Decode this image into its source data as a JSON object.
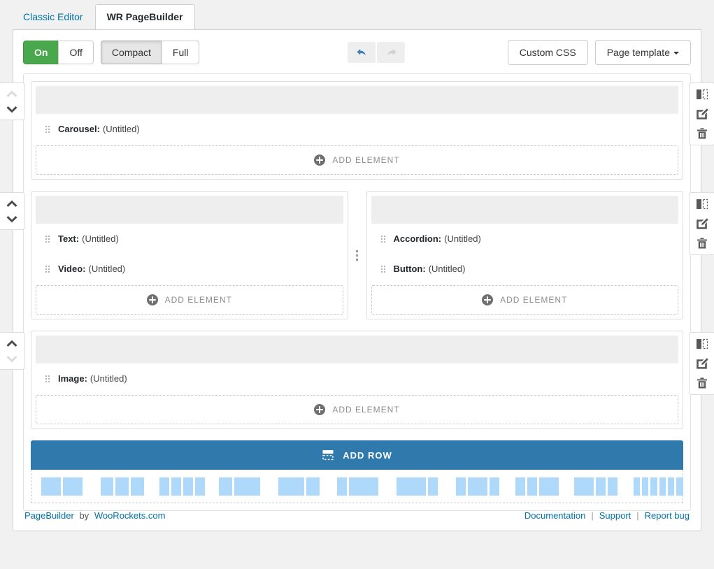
{
  "tabs": [
    {
      "label": "Classic Editor",
      "active": false,
      "name": "tab-classic-editor"
    },
    {
      "label": "WR PageBuilder",
      "active": true,
      "name": "tab-wr-pagebuilder"
    }
  ],
  "toolbar": {
    "on_label": "On",
    "off_label": "Off",
    "compact_label": "Compact",
    "full_label": "Full",
    "undo_icon": "undo-arrow-icon",
    "redo_icon": "redo-arrow-icon",
    "custom_css_label": "Custom CSS",
    "page_template_label": "Page template",
    "accent_green": "#48a84b",
    "accent_blue": "#3079ad",
    "link_blue": "#0073aa"
  },
  "rows": [
    {
      "name": "row-1",
      "move_up_enabled": false,
      "move_down_enabled": true,
      "columns": [
        {
          "name": "column-1-1",
          "elements": [
            {
              "type": "Carousel:",
              "title": "(Untitled)"
            }
          ],
          "add_element_label": "ADD ELEMENT"
        }
      ]
    },
    {
      "name": "row-2",
      "move_up_enabled": true,
      "move_down_enabled": true,
      "columns": [
        {
          "name": "column-2-1",
          "elements": [
            {
              "type": "Text:",
              "title": "(Untitled)"
            },
            {
              "type": "Video:",
              "title": "(Untitled)"
            }
          ],
          "add_element_label": "ADD ELEMENT"
        },
        {
          "name": "column-2-2",
          "elements": [
            {
              "type": "Accordion:",
              "title": "(Untitled)"
            },
            {
              "type": "Button:",
              "title": "(Untitled)"
            }
          ],
          "add_element_label": "ADD ELEMENT"
        }
      ]
    },
    {
      "name": "row-3",
      "move_up_enabled": true,
      "move_down_enabled": false,
      "columns": [
        {
          "name": "column-3-1",
          "elements": [
            {
              "type": "Image:",
              "title": "(Untitled)"
            }
          ],
          "add_element_label": "ADD ELEMENT"
        }
      ]
    }
  ],
  "row_controls": {
    "move_up_icon": "chevron-up-icon",
    "move_down_icon": "chevron-down-icon",
    "columns_icon": "columns-layout-icon",
    "edit_icon": "edit-pencil-icon",
    "delete_icon": "trash-icon"
  },
  "add_row": {
    "label": "ADD ROW",
    "icon": "add-row-icon",
    "layouts": [
      {
        "name": "layout-2-equal",
        "widths": [
          50,
          50
        ]
      },
      {
        "name": "layout-3-equal",
        "widths": [
          33.33,
          33.33,
          33.33
        ]
      },
      {
        "name": "layout-4-equal",
        "widths": [
          25,
          25,
          25,
          25
        ]
      },
      {
        "name": "layout-third-twothirds",
        "widths": [
          33.33,
          66.67
        ]
      },
      {
        "name": "layout-twothirds-third",
        "widths": [
          66.67,
          33.33
        ]
      },
      {
        "name": "layout-quarter-threequarters",
        "widths": [
          25,
          75
        ]
      },
      {
        "name": "layout-threequarters-quarter",
        "widths": [
          75,
          25
        ]
      },
      {
        "name": "layout-quarter-half-quarter",
        "widths": [
          25,
          50,
          25
        ]
      },
      {
        "name": "layout-quarter-quarter-half",
        "widths": [
          25,
          25,
          50
        ]
      },
      {
        "name": "layout-half-quarter-quarter",
        "widths": [
          50,
          25,
          25
        ]
      },
      {
        "name": "layout-6-equal",
        "widths": [
          16.6,
          16.6,
          16.6,
          16.6,
          16.6,
          16.6
        ]
      }
    ]
  },
  "footer": {
    "brand_name": "PageBuilder",
    "by_text": "by",
    "company": "WooRockets.com",
    "links": [
      {
        "label": "Documentation",
        "name": "footer-link-documentation"
      },
      {
        "label": "Support",
        "name": "footer-link-support"
      },
      {
        "label": "Report bug",
        "name": "footer-link-report-bug"
      }
    ],
    "separator": "|"
  }
}
